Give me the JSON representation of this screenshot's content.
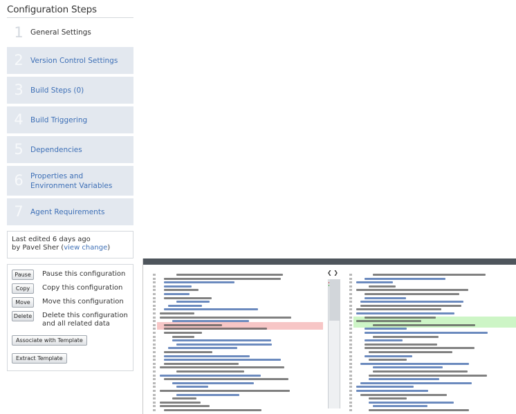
{
  "sidebar": {
    "title": "Configuration Steps",
    "steps": [
      {
        "num": "1",
        "label": "General Settings"
      },
      {
        "num": "2",
        "label": "Version Control Settings"
      },
      {
        "num": "3",
        "label": "Build Steps (0)"
      },
      {
        "num": "4",
        "label": "Build Triggering"
      },
      {
        "num": "5",
        "label": "Dependencies"
      },
      {
        "num": "6",
        "label": "Properties and Environment Variables"
      },
      {
        "num": "7",
        "label": "Agent Requirements"
      }
    ]
  },
  "edited": {
    "text": "Last edited 6 days ago",
    "by": "by Pavel Sher (",
    "link": "view change",
    "close": ")"
  },
  "actions": {
    "pause": {
      "button": "Pause",
      "desc": "Pause this configuration"
    },
    "copy": {
      "button": "Copy",
      "desc": "Copy this configuration"
    },
    "move": {
      "button": "Move",
      "desc": "Move this configuration"
    },
    "delete": {
      "button": "Delete",
      "desc": "Delete this configuration and all related data"
    },
    "associate": "Associate with Template",
    "extract": "Extract Template"
  },
  "diff": {
    "nav_glyphs": "❮ ❯"
  },
  "colors": {
    "accent_link": "#3d6fb6",
    "step_bg": "#e3e8ef",
    "removed_line": "#f7c6c6",
    "added_line": "#cdf5c6",
    "toolbar_bg": "#4e555c"
  }
}
